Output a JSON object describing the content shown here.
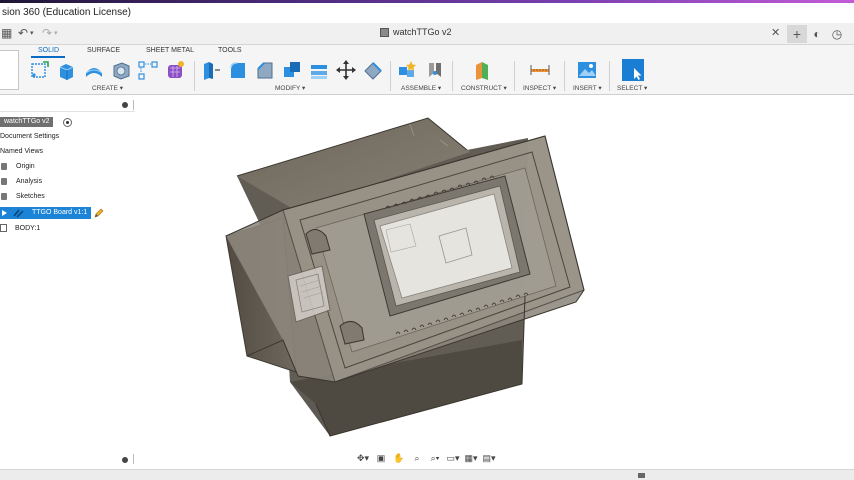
{
  "window": {
    "title": "sion 360 (Education License)"
  },
  "tabbar": {
    "document_title": "watchTTGo v2",
    "close_glyph": "✕",
    "new_tab_glyph": "+",
    "undo_glyph": "↶",
    "redo_glyph": "↷",
    "menu_glyph": "▦",
    "extensions_glyph": "◐",
    "clock_glyph": "◷",
    "help_glyph": "?"
  },
  "ribbon": {
    "tabs": [
      {
        "label": "SOLID",
        "active": true
      },
      {
        "label": "SURFACE",
        "active": false
      },
      {
        "label": "SHEET METAL",
        "active": false
      },
      {
        "label": "TOOLS",
        "active": false
      }
    ],
    "groups": {
      "create": "CREATE ▾",
      "modify": "MODIFY ▾",
      "assemble": "ASSEMBLE ▾",
      "construct": "CONSTRUCT ▾",
      "inspect": "INSPECT ▾",
      "insert": "INSERT ▾",
      "select": "SELECT ▾"
    },
    "colors": {
      "active_tab": "#0a6bc7",
      "tool_blue": "#2d8fe0",
      "select_blue": "#1a7fd4"
    }
  },
  "browser": {
    "root": "watchTTGo v2",
    "items": [
      {
        "label": "Document Settings"
      },
      {
        "label": "Named Views"
      },
      {
        "label": "Origin"
      },
      {
        "label": "Analysis"
      },
      {
        "label": "Sketches"
      },
      {
        "label": "TTGO Board v1:1",
        "selected": true
      },
      {
        "label": "BODY:1"
      }
    ],
    "selection_color": "#1b84d7"
  },
  "navbar": {
    "orbit": "✥▾",
    "look": "▣",
    "pan": "✋",
    "zoom": "⌕",
    "fit": "⌕▾",
    "display": "▭▾",
    "grid": "▦▾",
    "viewports": "▤▾"
  }
}
